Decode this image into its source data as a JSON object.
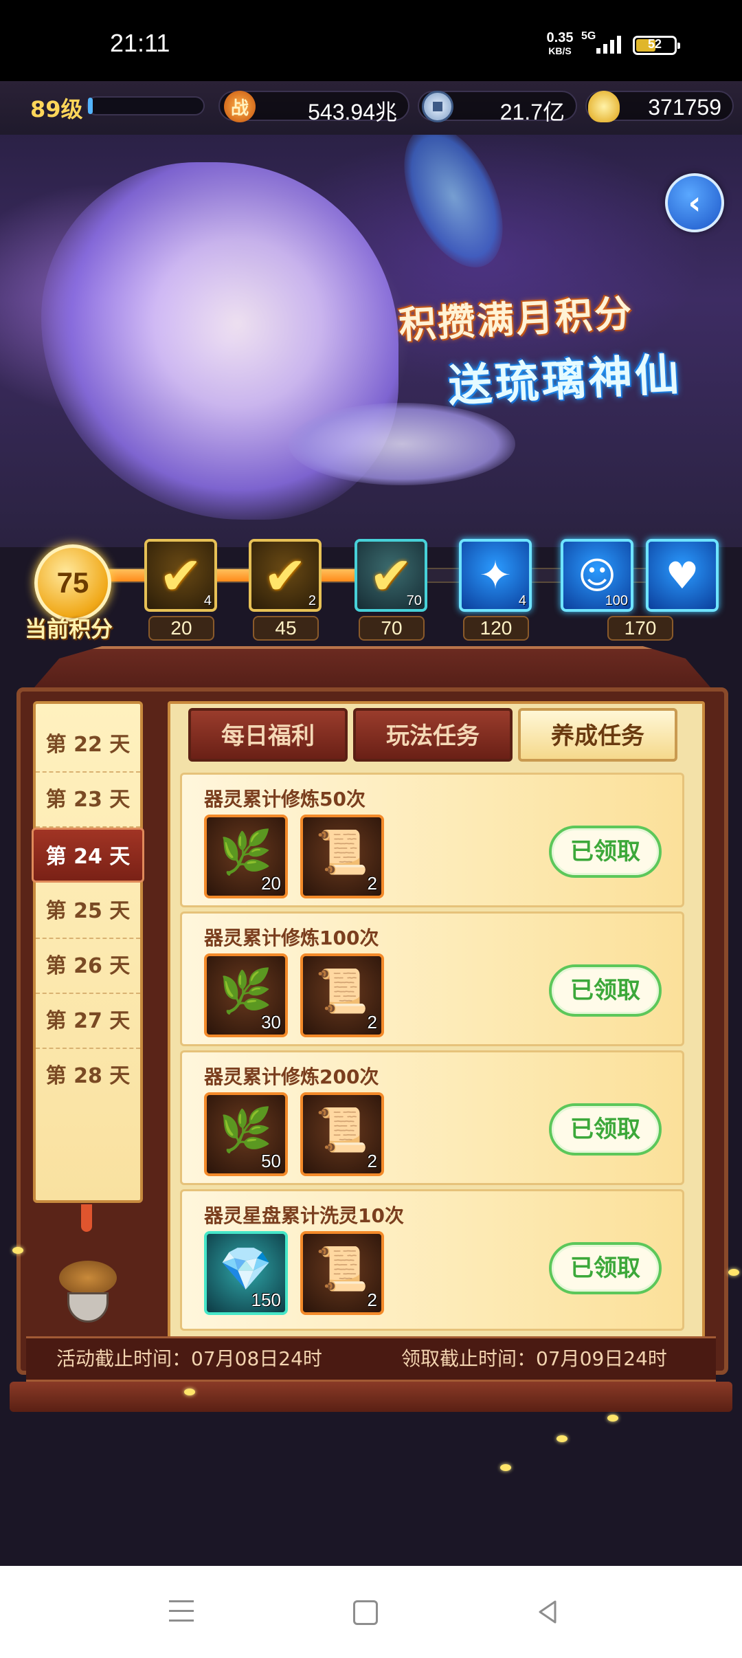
{
  "status_bar": {
    "time": "21:11",
    "net_speed": "0.35",
    "net_unit": "KB/S",
    "signal": "5G",
    "battery": "52"
  },
  "resources": {
    "level": "89级",
    "battle_icon": "战",
    "battle_power": "543.94兆",
    "silver": "21.7亿",
    "gold": "371759"
  },
  "banner": {
    "slogan_line1": "积攒满月积分",
    "slogan_line2": "送琉璃神仙"
  },
  "progress": {
    "current_points": "75",
    "current_points_label": "当前积分",
    "fill_fraction": 0.45,
    "milestones": [
      {
        "points": "20",
        "count": "4",
        "claimed": true
      },
      {
        "points": "45",
        "count": "2",
        "claimed": true
      },
      {
        "points": "70",
        "count": "70",
        "claimed": true
      },
      {
        "points": "120",
        "count": "4",
        "claimed": false
      },
      {
        "points": "",
        "count": "100",
        "claimed": false
      },
      {
        "points": "170",
        "count": "",
        "claimed": false
      }
    ]
  },
  "days": {
    "items": [
      "第 22 天",
      "第 23 天",
      "第 24 天",
      "第 25 天",
      "第 26 天",
      "第 27 天",
      "第 28 天"
    ],
    "active": "第 24 天"
  },
  "tabs": {
    "daily": "每日福利",
    "gameplay": "玩法任务",
    "growth": "养成任务",
    "active": "养成任务"
  },
  "tasks": [
    {
      "title": "器灵累计修炼50次",
      "rewards": [
        {
          "icon": "herb-icon",
          "count": "20"
        },
        {
          "icon": "scroll-icon",
          "count": "2"
        }
      ],
      "status": "已领取"
    },
    {
      "title": "器灵累计修炼100次",
      "rewards": [
        {
          "icon": "herb-icon",
          "count": "30"
        },
        {
          "icon": "scroll-icon",
          "count": "2"
        }
      ],
      "status": "已领取"
    },
    {
      "title": "器灵累计修炼200次",
      "rewards": [
        {
          "icon": "herb-icon",
          "count": "50"
        },
        {
          "icon": "scroll-icon",
          "count": "2"
        }
      ],
      "status": "已领取"
    },
    {
      "title": "器灵星盘累计洗灵10次",
      "rewards": [
        {
          "icon": "crystal-icon",
          "count": "150"
        },
        {
          "icon": "scroll-icon",
          "count": "2"
        }
      ],
      "status": "已领取"
    }
  ],
  "deadlines": {
    "activity": "活动截止时间：07月08日24时",
    "claim": "领取截止时间：07月09日24时"
  },
  "colors": {
    "accent_gold": "#ffd65a",
    "claimed_green": "#3ca83a",
    "panel_red": "#5a2418"
  }
}
